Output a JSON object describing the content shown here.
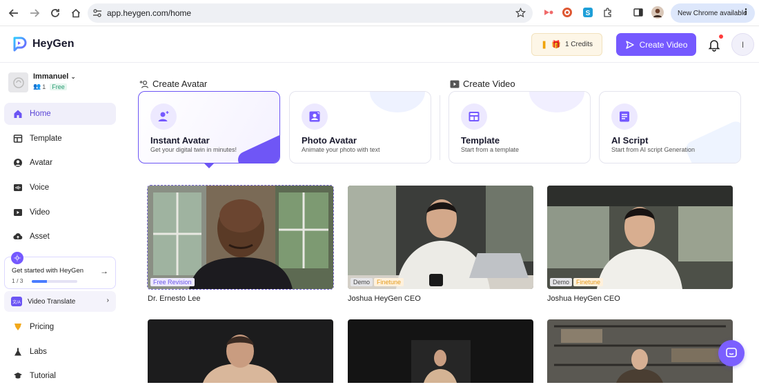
{
  "browser": {
    "url": "app.heygen.com/home",
    "chrome_notice": "New Chrome available"
  },
  "header": {
    "logo_text": "HeyGen",
    "credits_label": "1 Credits",
    "create_video_label": "Create Video",
    "avatar_initial": "I",
    "accent_color": "#7559ff"
  },
  "sidebar": {
    "workspace": {
      "name": "Immanuel",
      "members": "1",
      "plan": "Free"
    },
    "items": [
      {
        "label": "Home",
        "icon": "home-icon",
        "active": true
      },
      {
        "label": "Template",
        "icon": "template-icon"
      },
      {
        "label": "Avatar",
        "icon": "avatar-icon"
      },
      {
        "label": "Voice",
        "icon": "voice-icon"
      },
      {
        "label": "Video",
        "icon": "video-icon"
      },
      {
        "label": "Asset",
        "icon": "asset-icon"
      }
    ],
    "get_started": {
      "title": "Get started with HeyGen",
      "progress_text": "1 / 3",
      "progress": 0.33
    },
    "video_translate": {
      "badge": "文/A",
      "label": "Video Translate"
    },
    "bottom_items": [
      {
        "label": "Pricing",
        "icon": "pricing-icon"
      },
      {
        "label": "Labs",
        "icon": "labs-icon"
      },
      {
        "label": "Tutorial",
        "icon": "tutorial-icon"
      }
    ]
  },
  "main": {
    "create_avatar_label": "Create Avatar",
    "create_video_label": "Create Video",
    "cards": [
      {
        "title": "Instant Avatar",
        "subtitle": "Get your digital twin in minutes!"
      },
      {
        "title": "Photo Avatar",
        "subtitle": "Animate your photo with text"
      },
      {
        "title": "Template",
        "subtitle": "Start from a template"
      },
      {
        "title": "AI Script",
        "subtitle": "Start from AI script Generation"
      }
    ],
    "avatars": [
      {
        "name": "Dr. Ernesto Lee",
        "tags": [
          "Free Revision"
        ]
      },
      {
        "name": "Joshua HeyGen CEO",
        "tags": [
          "Demo",
          "Finetune"
        ]
      },
      {
        "name": "Joshua HeyGen CEO",
        "tags": [
          "Demo",
          "Finetune"
        ]
      }
    ]
  }
}
